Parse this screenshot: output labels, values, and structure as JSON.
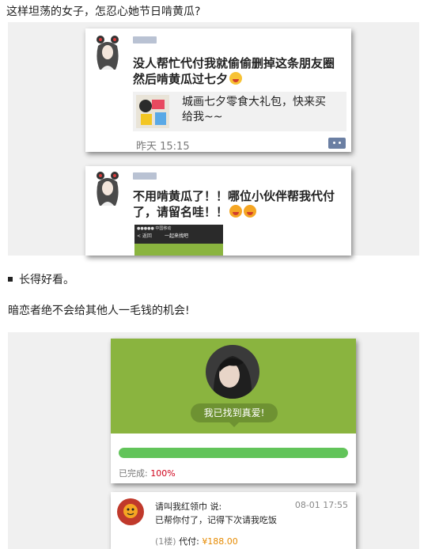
{
  "heading": "这样坦荡的女子，怎忍心她节日啃黄瓜?",
  "post1": {
    "line1": "没人帮忙代付我就偷偷删掉这条朋友圈",
    "line2": "然后啃黄瓜过七夕",
    "share_line1": "城画七夕零食大礼包，快来买",
    "share_line2": "给我~~",
    "time": "昨天 15:15"
  },
  "post2": {
    "line1": "不用啃黄瓜了！！哪位小伙伴帮我代付",
    "line2": "了，请留名哇！！",
    "mini_status": "●●●●● 中国移动",
    "mini_back": "< 返回",
    "mini_title": "一起来找吧"
  },
  "bullet": "长得好看。",
  "paragraph": "暗恋者绝不会给其他人一毛钱的机会!",
  "payment": {
    "found_label": "我已找到真爱!",
    "progress_fraction": 1.0,
    "completed_label": "已完成:",
    "completed_value": "100%",
    "commenter": "请叫我红领巾 说:",
    "date": "08-01 17:55",
    "comment": "已帮你付了，记得下次请我吃饭",
    "floor": "(1楼)",
    "pay_label": "代付:",
    "amount": "¥188.00"
  },
  "colors": {
    "green": "#8ab43f",
    "progress": "#62c45a",
    "red": "#d0021b",
    "orange": "#e68a00"
  }
}
